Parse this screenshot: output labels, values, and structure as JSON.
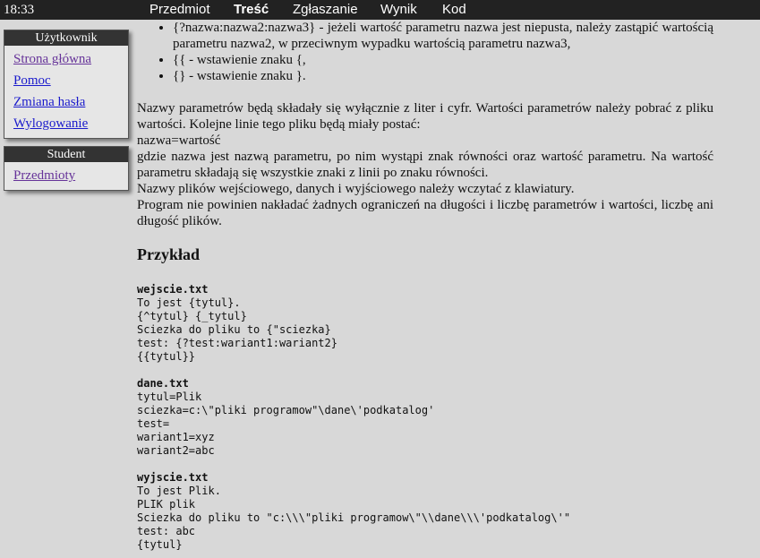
{
  "topbar": {
    "clock": "18:33",
    "nav": [
      {
        "label": "Przedmiot"
      },
      {
        "label": "Treść"
      },
      {
        "label": "Zgłaszanie"
      },
      {
        "label": "Wynik"
      },
      {
        "label": "Kod"
      }
    ]
  },
  "sidebar": {
    "user_box": {
      "title": "Użytkownik",
      "items": [
        "Strona główna",
        "Pomoc",
        "Zmiana hasła",
        "Wylogowanie"
      ]
    },
    "student_box": {
      "title": "Student",
      "items": [
        "Przedmioty"
      ]
    }
  },
  "content": {
    "bullets": [
      "{?nazwa:nazwa2:nazwa3} - jeżeli wartość parametru nazwa jest niepusta, należy zastąpić wartością parametru nazwa2, w przeciwnym wypadku wartością parametru nazwa3,",
      "{{ - wstawienie znaku {,",
      "{} - wstawienie znaku }."
    ],
    "paragraph1": "Nazwy parametrów będą składały się wyłącznie z liter i cyfr. Wartości parametrów należy pobrać z pliku wartości. Kolejne linie tego pliku będą miały postać:",
    "paragraph1_line": "nazwa=wartość",
    "paragraph2": "gdzie nazwa jest nazwą parametru, po nim wystąpi znak równości oraz wartość parametru. Na wartość parametru składają się wszystkie znaki z linii po znaku równości.",
    "paragraph3": "Nazwy plików wejściowego, danych i wyjściowego należy wczytać z klawiatury.",
    "paragraph4": "Program nie powinien nakładać żadnych ograniczeń na długości i liczbę parametrów i wartości, liczbę ani długość plików.",
    "example_heading": "Przykład",
    "files": [
      {
        "name": "wejscie.txt",
        "lines": [
          "To jest {tytul}.",
          "{^tytul} {_tytul}",
          "Sciezka do pliku to {\"sciezka}",
          "test: {?test:wariant1:wariant2}",
          "{{tytul}}"
        ]
      },
      {
        "name": "dane.txt",
        "lines": [
          "tytul=Plik",
          "sciezka=c:\\\"pliki programow\"\\dane\\'podkatalog'",
          "test=",
          "wariant1=xyz",
          "wariant2=abc"
        ]
      },
      {
        "name": "wyjscie.txt",
        "lines": [
          "To jest Plik.",
          "PLIK plik",
          "Sciezka do pliku to \"c:\\\\\\\"pliki programow\\\"\\\\dane\\\\\\'podkatalog\\'\"",
          "test: abc",
          "{tytul}"
        ]
      }
    ]
  }
}
